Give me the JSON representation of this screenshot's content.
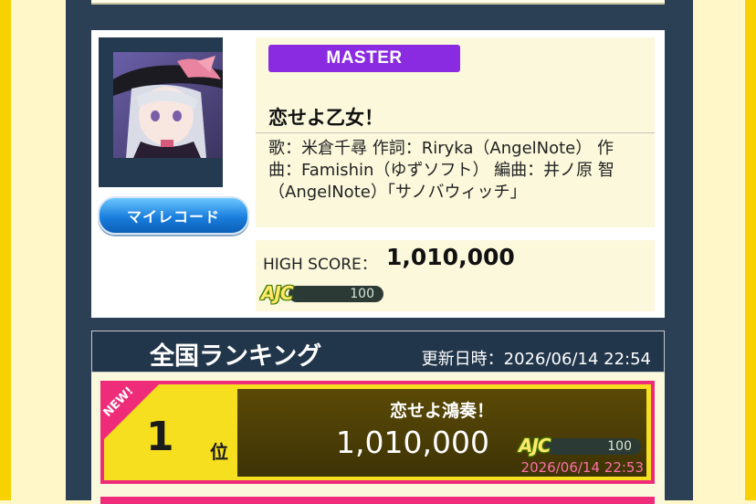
{
  "song": {
    "difficulty": "MASTER",
    "title": "恋せよ乙女！",
    "credits": "歌：米倉千尋 作詞：Riryka（AngelNote） 作曲：Famishin（ゆずソフト） 編曲：井ノ原 智（AngelNote）「サノバウィッチ」",
    "my_record_label": "マイレコード",
    "high_score_label": "HIGH SCORE：",
    "high_score": "1,010,000",
    "ajc_label": "AJC",
    "ajc_value": "100"
  },
  "ranking": {
    "title": "全国ランキング",
    "updated": "更新日時：2026/06/14 22:54",
    "entries": [
      {
        "badge": "NEW!",
        "rank": "1",
        "rank_suffix": "位",
        "name": "恋せよ鴻奏！",
        "score": "1,010,000",
        "ajc_label": "AJC",
        "ajc_value": "100",
        "date": "2026/06/14 22:53"
      }
    ]
  },
  "colors": {
    "rail": "#f7d200",
    "background": "#fff7c8",
    "panel": "#2b3f55",
    "master": "#8a2be2",
    "rank_border": "#ee2c79"
  },
  "icons": {
    "jacket": "song-jacket-artwork",
    "ajc": "ajc-badge-icon"
  }
}
